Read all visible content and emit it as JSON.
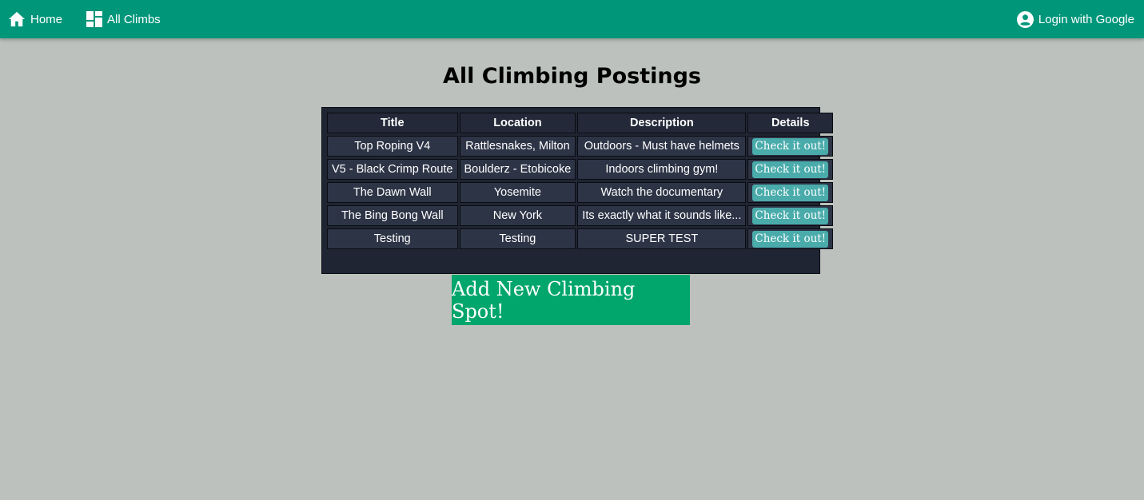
{
  "nav": {
    "home_label": "Home",
    "climbs_label": "All Climbs",
    "login_label": "Login with Google"
  },
  "page": {
    "title": "All Climbing Postings"
  },
  "table": {
    "headers": {
      "title": "Title",
      "location": "Location",
      "description": "Description",
      "details": "Details"
    },
    "rows": [
      {
        "title": "Top Roping V4",
        "location": "Rattlesnakes, Milton",
        "description": "Outdoors - Must have helmets",
        "action": "Check it out!"
      },
      {
        "title": "V5 - Black Crimp Route",
        "location": "Boulderz - Etobicoke",
        "description": "Indoors climbing gym!",
        "action": "Check it out!"
      },
      {
        "title": "The Dawn Wall",
        "location": "Yosemite",
        "description": "Watch the documentary",
        "action": "Check it out!"
      },
      {
        "title": "The Bing Bong Wall",
        "location": "New York",
        "description": "Its exactly what it sounds like...",
        "action": "Check it out!"
      },
      {
        "title": "Testing",
        "location": "Testing",
        "description": "SUPER TEST",
        "action": "Check it out!"
      }
    ]
  },
  "add_button": {
    "label": "Add New Climbing Spot!"
  },
  "icons": {
    "home": "home-icon",
    "climbs": "dashboard-icon",
    "login": "account-circle-icon"
  },
  "colors": {
    "navbar": "#00967a",
    "background": "#bcc1bd",
    "table_bg": "#1f2532",
    "cell_bg": "#2d3446",
    "check_button": "#4aabab",
    "add_button": "#00a66c"
  }
}
